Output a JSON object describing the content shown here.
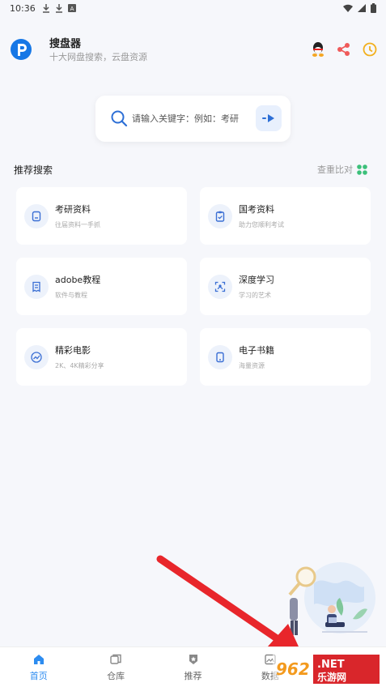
{
  "status_bar": {
    "time": "10:36"
  },
  "header": {
    "app_name": "搜盘器",
    "subtitle": "十大网盘搜索，云盘资源"
  },
  "search": {
    "placeholder": "请输入关键字：例如：考研"
  },
  "section": {
    "title": "推荐搜索",
    "right_label": "查重比对"
  },
  "cards": [
    {
      "title": "考研资料",
      "sub": "往届资料一手抓",
      "icon": "document-icon"
    },
    {
      "title": "国考资料",
      "sub": "助力您顺利考试",
      "icon": "clipboard-icon"
    },
    {
      "title": "adobe教程",
      "sub": "软件与教程",
      "icon": "receipt-icon"
    },
    {
      "title": "深度学习",
      "sub": "学习的艺术",
      "icon": "scan-icon"
    },
    {
      "title": "精彩电影",
      "sub": "2K、4K精彩分享",
      "icon": "chart-icon"
    },
    {
      "title": "电子书籍",
      "sub": "海量资源",
      "icon": "tablet-icon"
    }
  ],
  "tabs": [
    {
      "label": "首页",
      "active": true,
      "icon": "home-icon"
    },
    {
      "label": "仓库",
      "active": false,
      "icon": "copy-icon"
    },
    {
      "label": "推荐",
      "active": false,
      "icon": "badge-icon"
    },
    {
      "label": "数据",
      "active": false,
      "icon": "image-icon"
    },
    {
      "label": "",
      "active": false,
      "icon": "user-icon"
    }
  ],
  "watermark": {
    "text_logo": "962.NET",
    "text_cn": "乐游网"
  },
  "colors": {
    "accent": "#2d8cf0",
    "logo_blue": "#1677e6",
    "arrow_red": "#e8262b"
  }
}
